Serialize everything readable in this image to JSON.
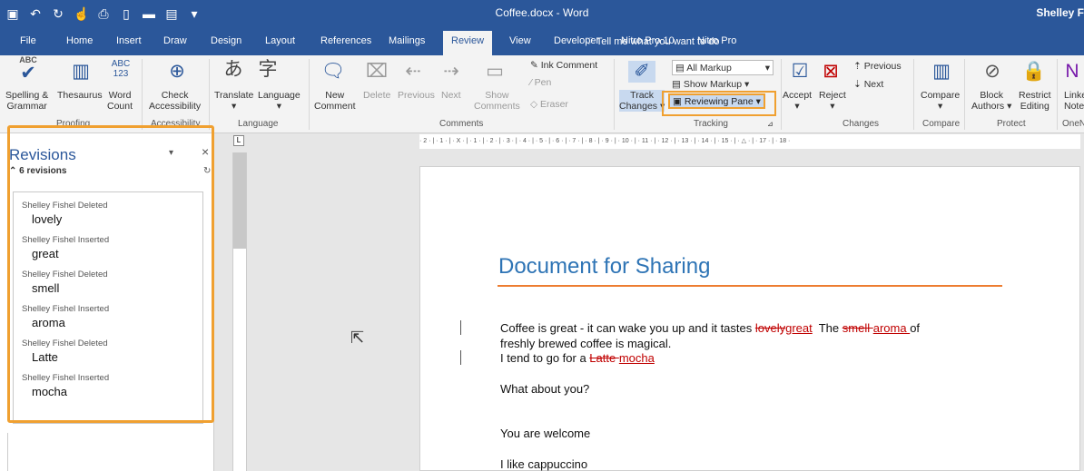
{
  "window": {
    "title": "Coffee.docx - Word",
    "user": "Shelley F"
  },
  "qat": [
    "save-icon",
    "undo-icon",
    "redo-icon",
    "touch-icon",
    "print-icon",
    "new-icon",
    "open-icon",
    "preview-icon",
    "more-icon"
  ],
  "tabs": [
    "File",
    "Home",
    "Insert",
    "Draw",
    "Design",
    "Layout",
    "References",
    "Mailings",
    "Review",
    "View",
    "Developer",
    "Nitro Pro 10",
    "Nitro Pro"
  ],
  "active_tab": "Review",
  "tellme": "Tell me what you want to do",
  "ribbon": {
    "proofing": {
      "label": "Proofing",
      "spelling_top": "ABC",
      "spelling": "Spelling &",
      "thesaurus": "Thesaurus",
      "wordcount_top": "ABC",
      "wordcount_num": "123",
      "grammar": "Grammar",
      "word": "Word",
      "count": "Count"
    },
    "accessibility": {
      "label": "Accessibility",
      "check": "Check",
      "accessibility": "Accessibility"
    },
    "language": {
      "label": "Language",
      "translate": "Translate",
      "language": "Language"
    },
    "comments": {
      "label": "Comments",
      "new": "New",
      "comment": "Comment",
      "delete": "Delete",
      "previous": "Previous",
      "next": "Next",
      "show": "Show",
      "comments": "Comments",
      "ink_comment": "Ink Comment",
      "pen": "Pen",
      "eraser": "Eraser"
    },
    "tracking": {
      "label": "Tracking",
      "track": "Track",
      "changes": "Changes",
      "all_markup": "All Markup",
      "show_markup": "Show Markup",
      "reviewing_pane": "Reviewing Pane"
    },
    "changes": {
      "label": "Changes",
      "accept": "Accept",
      "reject": "Reject",
      "previous": "Previous",
      "next": "Next"
    },
    "compare": {
      "label": "Compare",
      "compare": "Compare"
    },
    "protect": {
      "label": "Protect",
      "block": "Block",
      "authors": "Authors",
      "restrict": "Restrict",
      "editing": "Editing"
    },
    "onenote": {
      "label": "OneN",
      "linked": "Linke",
      "notes": "Note"
    }
  },
  "ruler": "· 2 · | · 1 · | · X · | · 1 · | · 2 · | · 3 · | · 4 · | · 5 · | · 6 · | · 7 · | · 8 · | · 9 · | · 10 · | · 11 · | · 12 · | · 13 · | · 14 · | · 15 · | · △ · | · 17 · | · 18 ·",
  "revisions_pane": {
    "title": "Revisions",
    "count": "6 revisions",
    "items": [
      {
        "author": "Shelley Fishel Deleted",
        "text": "lovely"
      },
      {
        "author": "Shelley Fishel Inserted",
        "text": "great"
      },
      {
        "author": "Shelley Fishel Deleted",
        "text": "smell"
      },
      {
        "author": "Shelley Fishel Inserted",
        "text": "aroma"
      },
      {
        "author": "Shelley Fishel Deleted",
        "text": "Latte"
      },
      {
        "author": "Shelley Fishel Inserted",
        "text": "mocha"
      }
    ]
  },
  "document": {
    "heading": "Document for Sharing",
    "p1": {
      "a": "Coffee is great - it can wake you up and it tastes ",
      "del1": "lovely",
      "ins1": "great",
      "b": "  The ",
      "del2": "smell ",
      "ins2": "aroma ",
      "c": "of"
    },
    "p2": "freshly brewed coffee is magical.",
    "p3": {
      "a": "I tend to go for a ",
      "del": "Latte ",
      "ins": "mocha"
    },
    "p4": "What about you?",
    "p5": "You are welcome",
    "p6": "I like cappuccino"
  },
  "colors": {
    "brand": "#2b579a",
    "highlight": "#f0a030",
    "heading": "#2e74b5",
    "rule": "#ed7d31",
    "revision": "#c00000"
  }
}
